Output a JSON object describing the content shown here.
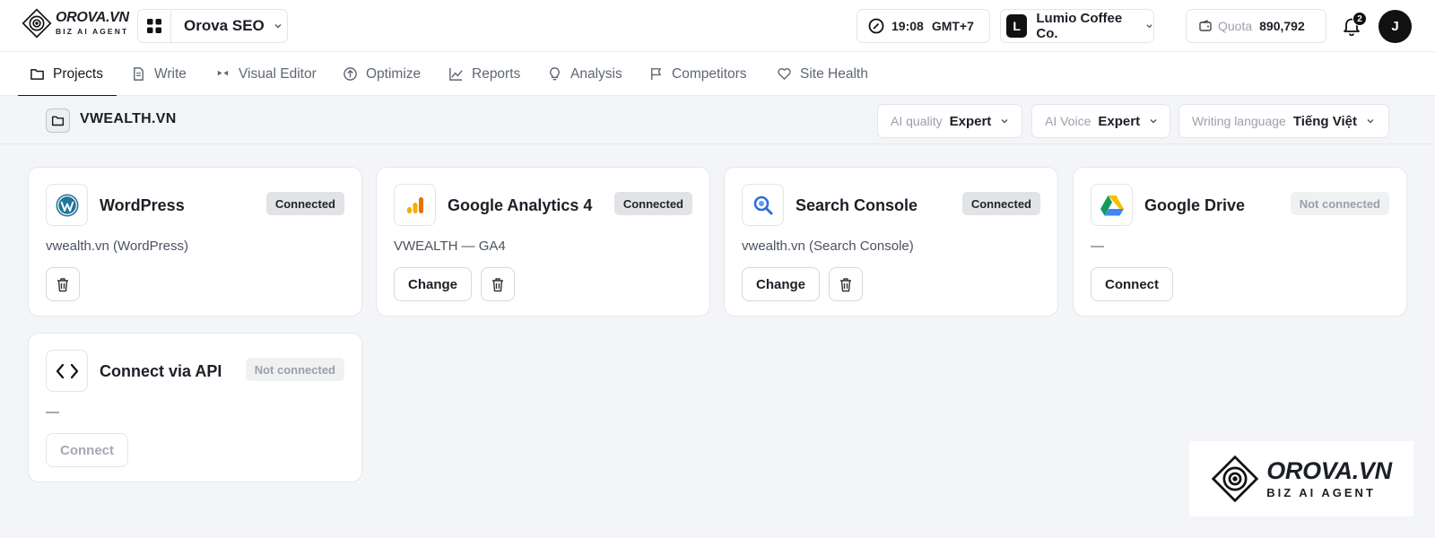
{
  "brand": {
    "name": "OROVA.VN",
    "tagline": "BIZ AI AGENT"
  },
  "header": {
    "app_name": "Orova SEO",
    "time": "19:08",
    "timezone": "GMT+7",
    "org_initial": "L",
    "org_name": "Lumio Coffee Co.",
    "quota_label": "Quota",
    "quota_value": "890,792",
    "notifications_count": "2",
    "user_initial": "J"
  },
  "nav": {
    "tabs": [
      {
        "label": "Projects",
        "icon": "folder-icon",
        "active": true
      },
      {
        "label": "Write",
        "icon": "document-icon"
      },
      {
        "label": "Visual Editor",
        "icon": "bow-tie-icon"
      },
      {
        "label": "Optimize",
        "icon": "arrow-up-circle-icon"
      },
      {
        "label": "Reports",
        "icon": "line-chart-icon"
      },
      {
        "label": "Analysis",
        "icon": "lightbulb-icon"
      },
      {
        "label": "Competitors",
        "icon": "flag-icon"
      },
      {
        "label": "Site Health",
        "icon": "heart-icon"
      }
    ]
  },
  "project": {
    "title": "VWEALTH.VN",
    "ai_quality_label": "AI quality",
    "ai_quality_value": "Expert",
    "ai_voice_label": "AI Voice",
    "ai_voice_value": "Expert",
    "language_label": "Writing language",
    "language_value": "Tiếng Việt"
  },
  "integrations": [
    {
      "name": "WordPress",
      "status": "Connected",
      "detail": "vwealth.vn (WordPress)",
      "icon": "wordpress-icon"
    },
    {
      "name": "Google Analytics 4",
      "status": "Connected",
      "detail": "VWEALTH — GA4",
      "action": "Change",
      "icon": "analytics-icon"
    },
    {
      "name": "Search Console",
      "status": "Connected",
      "detail": "vwealth.vn (Search Console)",
      "action": "Change",
      "icon": "search-icon"
    },
    {
      "name": "Google Drive",
      "status": "Not connected",
      "detail": "—",
      "action": "Connect",
      "icon": "google-drive-icon"
    },
    {
      "name": "Connect via API",
      "status": "Not connected",
      "detail": "—",
      "action": "Connect",
      "icon": "code-icon"
    }
  ],
  "colors": {
    "accent": "#111111",
    "analytics_orange": "#f5a623",
    "search_blue": "#2f6fd6"
  }
}
